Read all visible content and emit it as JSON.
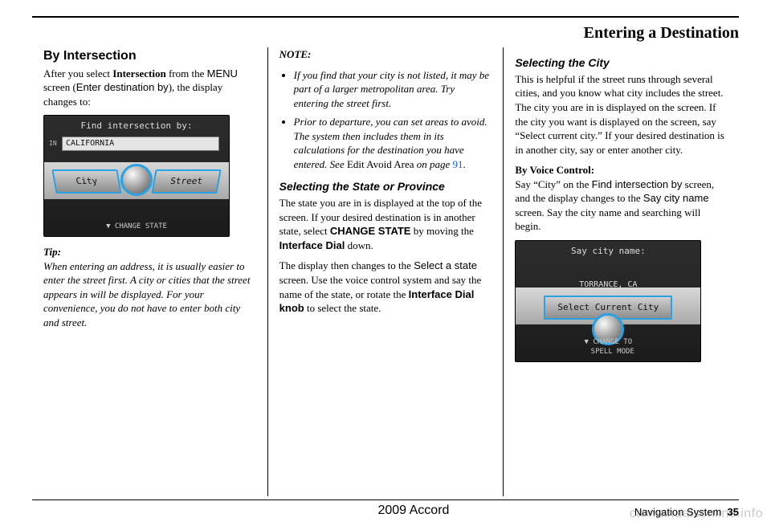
{
  "page_title": "Entering a Destination",
  "footer": {
    "model_year": "2009  Accord",
    "section_label": "Navigation System",
    "page_number": "35"
  },
  "watermark": "carmanualsonline.info",
  "col1": {
    "h2": "By Intersection",
    "p1_a": "After you select ",
    "p1_b": "Intersection",
    "p1_c": " from the ",
    "p1_d": "MENU",
    "p1_e": " screen (",
    "p1_f": "Enter destination by",
    "p1_g": "), the display changes to:",
    "screen": {
      "title": "Find intersection by:",
      "in": "IN",
      "state": "CALIFORNIA",
      "btn_city": "City",
      "btn_street": "Street",
      "footer": "▼ CHANGE STATE"
    },
    "tip_label": "Tip:",
    "tip_body": "When entering an address, it is usually easier to enter the street first. A city or cities that the street appears in will be displayed. For your convenience, you do not have to enter both city and street."
  },
  "col2": {
    "note_label": "NOTE:",
    "note1": "If you find that your city is not listed, it may be part of a larger metropolitan area. Try entering the street first.",
    "note2_a": "Prior to departure, you can set areas to avoid. The system then includes them in its calculations for the destination you have entered. See ",
    "note2_b": "Edit Avoid Area",
    "note2_c": " on page ",
    "note2_page": "91",
    "note2_d": ".",
    "h3": "Selecting the State or Province",
    "p2_a": "The state you are in is displayed at the top of the screen. If your desired destination is in another state, select ",
    "p2_b": "CHANGE STATE",
    "p2_c": " by moving the ",
    "p2_d": "Interface Dial",
    "p2_e": " down.",
    "p3_a": "The display then changes to the ",
    "p3_b": "Select a state",
    "p3_c": " screen. Use the voice control system and say the name of the state, or rotate the ",
    "p3_d": "Interface Dial knob",
    "p3_e": " to select the state."
  },
  "col3": {
    "h3": "Selecting the City",
    "p1": "This is helpful if the street runs through several cities, and you know what city includes the street. The city you are in is displayed on the screen. If the city you want is displayed on the screen, say “Select current city.” If your desired destination is in another city, say or enter another city.",
    "voice_label": "By Voice Control:",
    "p2_a": "Say “City” on the ",
    "p2_b": "Find intersection by",
    "p2_c": " screen, and the display changes to the ",
    "p2_d": "Say city name",
    "p2_e": " screen. Say the city name and searching will begin.",
    "screen": {
      "title": "Say city name:",
      "city": "TORRANCE, CA",
      "btn": "Select Current City",
      "footer": "▼ CHANGE TO\n  SPELL MODE"
    }
  }
}
